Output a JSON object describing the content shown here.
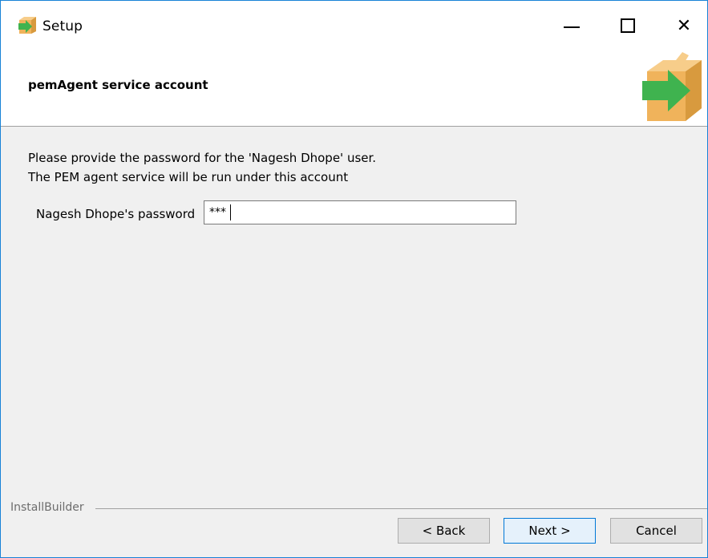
{
  "window": {
    "title": "Setup",
    "app_icon": "box-arrow-icon",
    "controls": {
      "minimize": "minimize-icon",
      "maximize": "maximize-icon",
      "close": "close-icon",
      "close_glyph": "✕"
    }
  },
  "header": {
    "title": "pemAgent service account",
    "icon": "box-arrow-icon"
  },
  "body": {
    "line1": "Please provide the password for the 'Nagesh Dhope' user.",
    "line2": "The PEM agent service will be run under this account",
    "password_label": "Nagesh Dhope's password",
    "password_value": "***"
  },
  "footer": {
    "brand": "InstallBuilder",
    "back_label": "< Back",
    "next_label": "Next >",
    "cancel_label": "Cancel"
  },
  "colors": {
    "window_border": "#1883d7",
    "box": "#f0b35b",
    "arrow": "#3fb34f",
    "default_button_border": "#0078d7"
  }
}
